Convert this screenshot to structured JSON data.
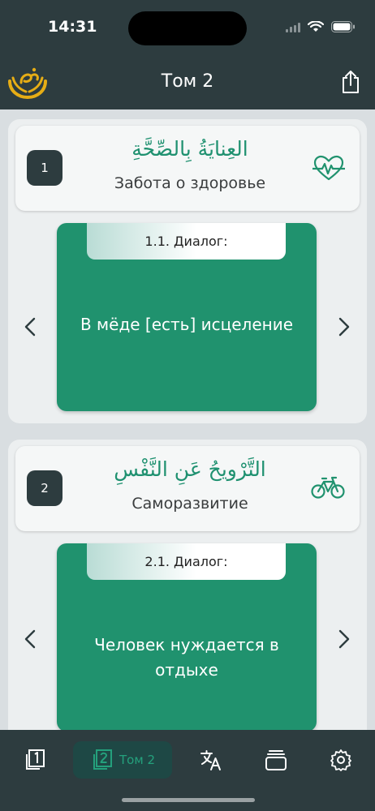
{
  "status": {
    "time": "14:31"
  },
  "nav": {
    "title": "Том 2"
  },
  "sections": [
    {
      "number": "1",
      "arabic": "العِنايَةُ بِالصِّحَّةِ",
      "title": "Забота о здоровье",
      "icon": "heartbeat-icon",
      "card": {
        "tab": "1.1. Диалог:",
        "text": "В мёде [есть] исцеление"
      }
    },
    {
      "number": "2",
      "arabic": "التَّرْويحُ عَنِ النَّفْسِ",
      "title": "Саморазвитие",
      "icon": "bicycle-icon",
      "card": {
        "tab": "2.1. Диалог:",
        "text": "Человек нуждается в отдыхе"
      }
    }
  ],
  "tabbar": {
    "active_label": "Том 2",
    "items": [
      "volume-1-icon",
      "volume-2-icon",
      "translate-icon",
      "cards-icon",
      "settings-icon"
    ]
  },
  "colors": {
    "accent": "#20926e",
    "dark": "#2d3c3f",
    "gold": "#e6ad15"
  }
}
